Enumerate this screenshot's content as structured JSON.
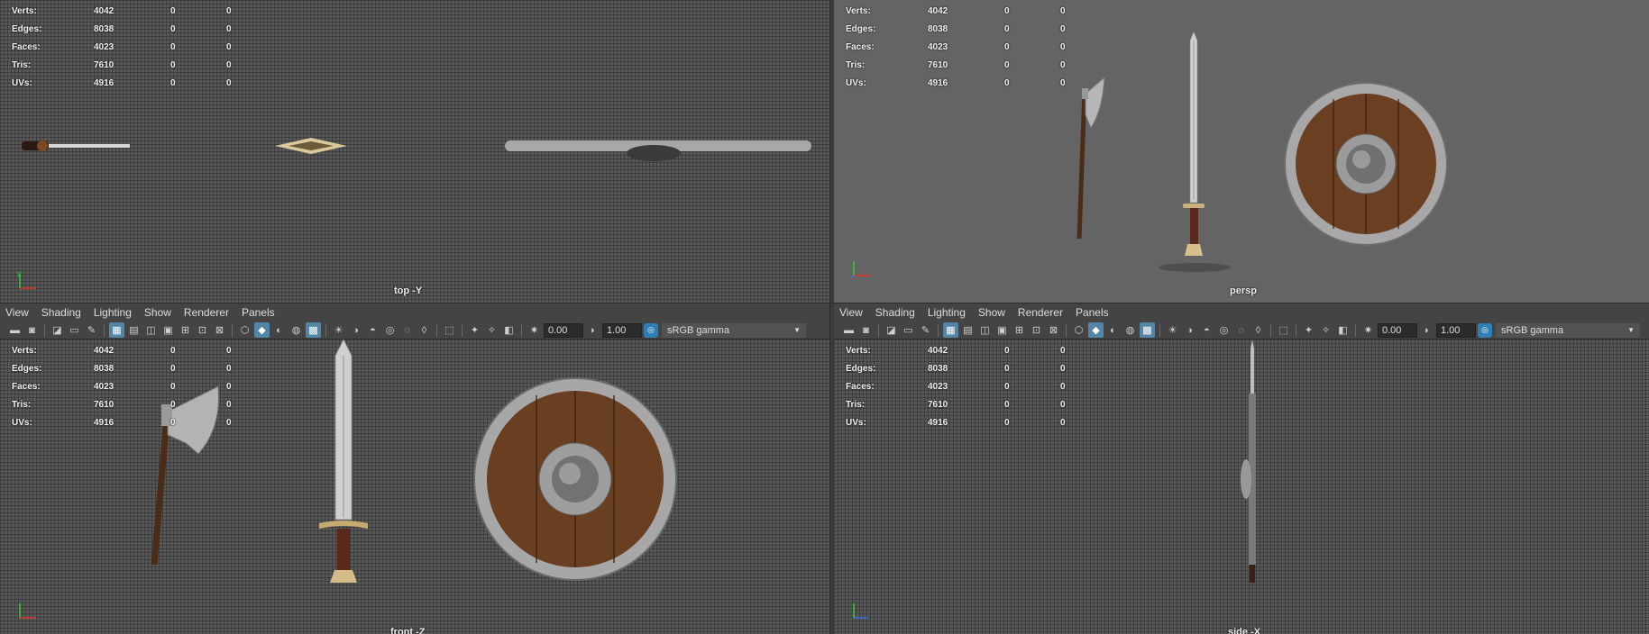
{
  "menu": [
    "View",
    "Shading",
    "Lighting",
    "Show",
    "Renderer",
    "Panels"
  ],
  "toolbar": {
    "exposure": "0.00",
    "gamma": "1.00",
    "colorspace": "sRGB gamma",
    "icons": [
      "camera-icon",
      "camera-attr-icon",
      "bookmark-icon",
      "image-plane-icon",
      "grease-pencil-icon",
      "grid-icon",
      "film-gate-icon",
      "resolution-gate-icon",
      "gate-mask-icon",
      "field-chart-icon",
      "safe-action-icon",
      "safe-title-icon",
      "wireframe-icon",
      "smooth-shade-icon",
      "default-material-icon",
      "xray-icon",
      "textured-icon",
      "use-lights-icon",
      "shadows-icon",
      "ambient-occlusion-icon",
      "motion-blur-icon",
      "anti-alias-icon",
      "depth-of-field-icon",
      "isolate-select-icon",
      "xray-joints-icon",
      "xray-active-icon",
      "backface-culling-icon",
      "exposure-icon",
      "gamma-icon",
      "colorspace-icon"
    ]
  },
  "hud": {
    "rows": [
      {
        "label": "Verts:",
        "v1": "4042",
        "v2": "0",
        "v3": "0"
      },
      {
        "label": "Edges:",
        "v1": "8038",
        "v2": "0",
        "v3": "0"
      },
      {
        "label": "Faces:",
        "v1": "4023",
        "v2": "0",
        "v3": "0"
      },
      {
        "label": "Tris:",
        "v1": "7610",
        "v2": "0",
        "v3": "0"
      },
      {
        "label": "UVs:",
        "v1": "4916",
        "v2": "0",
        "v3": "0"
      }
    ]
  },
  "panels": {
    "top": {
      "camera": "top -Y"
    },
    "persp": {
      "camera": "persp"
    },
    "front": {
      "camera": "front -Z"
    },
    "side": {
      "camera": "side -X"
    }
  },
  "axis_labels": {
    "x": "x",
    "y": "y",
    "z": "z"
  },
  "colors": {
    "accent": "#5285a6",
    "axis_x": "#e0332d",
    "axis_y": "#35c935",
    "axis_z": "#3a6fe0"
  }
}
